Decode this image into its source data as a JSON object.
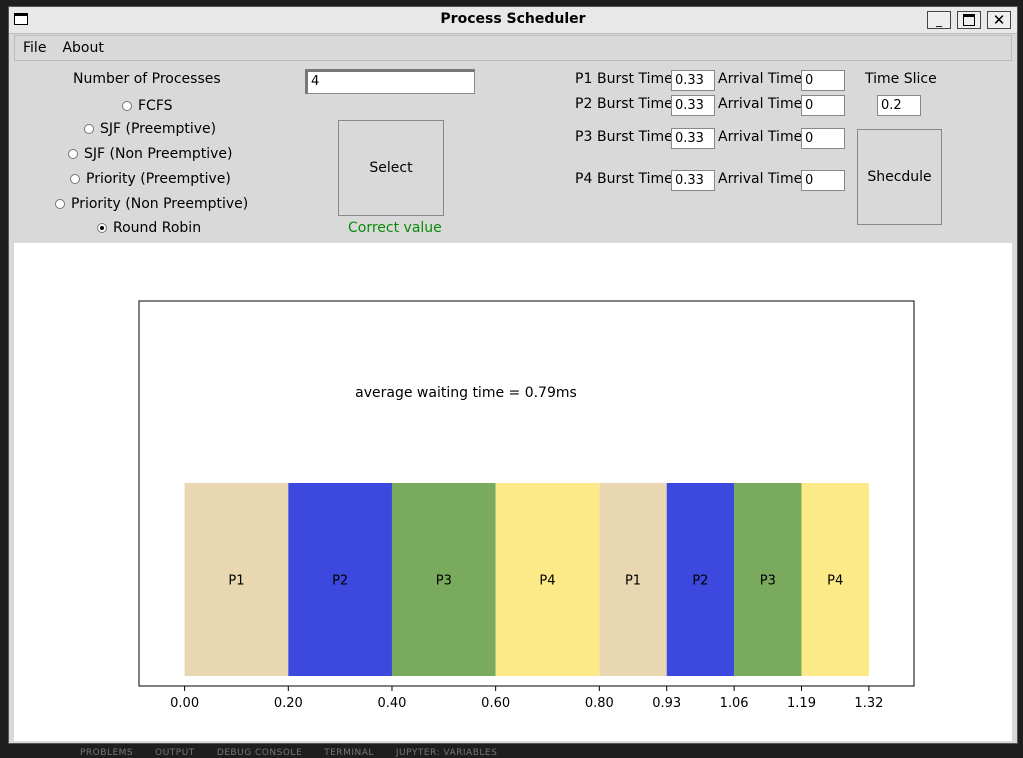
{
  "window": {
    "title": "Process Scheduler"
  },
  "menu": {
    "file": "File",
    "about": "About"
  },
  "form": {
    "num_processes_label": "Number of Processes",
    "num_processes_value": "4",
    "algorithms": [
      "FCFS",
      "SJF (Preemptive)",
      "SJF (Non Preemptive)",
      "Priority (Preemptive)",
      "Priority (Non Preemptive)",
      "Round Robin"
    ],
    "selected_algorithm": "Round Robin",
    "select_label": "Select",
    "status": "Correct value",
    "burst_label": "Burst Time",
    "arrival_label": "Arrival Time",
    "processes": [
      {
        "name": "P1",
        "burst": "0.33",
        "arrival": "0"
      },
      {
        "name": "P2",
        "burst": "0.33",
        "arrival": "0"
      },
      {
        "name": "P3",
        "burst": "0.33",
        "arrival": "0"
      },
      {
        "name": "P4",
        "burst": "0.33",
        "arrival": "0"
      }
    ],
    "time_slice_label": "Time Slice",
    "time_slice_value": "0.2",
    "schedule_label": "Shecdule"
  },
  "colors": {
    "P1": "#e8d7b0",
    "P2": "#3c48de",
    "P3": "#7aaa5e",
    "P4": "#fbea87"
  },
  "chart_data": {
    "type": "bar",
    "title": "average waiting time = 0.79ms",
    "segments": [
      {
        "label": "P1",
        "start": 0.0,
        "end": 0.2
      },
      {
        "label": "P2",
        "start": 0.2,
        "end": 0.4
      },
      {
        "label": "P3",
        "start": 0.4,
        "end": 0.6
      },
      {
        "label": "P4",
        "start": 0.6,
        "end": 0.8
      },
      {
        "label": "P1",
        "start": 0.8,
        "end": 0.93
      },
      {
        "label": "P2",
        "start": 0.93,
        "end": 1.06
      },
      {
        "label": "P3",
        "start": 1.06,
        "end": 1.19
      },
      {
        "label": "P4",
        "start": 1.19,
        "end": 1.32
      }
    ],
    "xticks": [
      "0.00",
      "0.20",
      "0.40",
      "0.60",
      "0.80",
      "0.93",
      "1.06",
      "1.19",
      "1.32"
    ],
    "xlim": [
      -0.088,
      1.407
    ],
    "grid": false
  },
  "bottom_tabs": [
    "PROBLEMS",
    "OUTPUT",
    "DEBUG CONSOLE",
    "TERMINAL",
    "JUPYTER: VARIABLES"
  ]
}
